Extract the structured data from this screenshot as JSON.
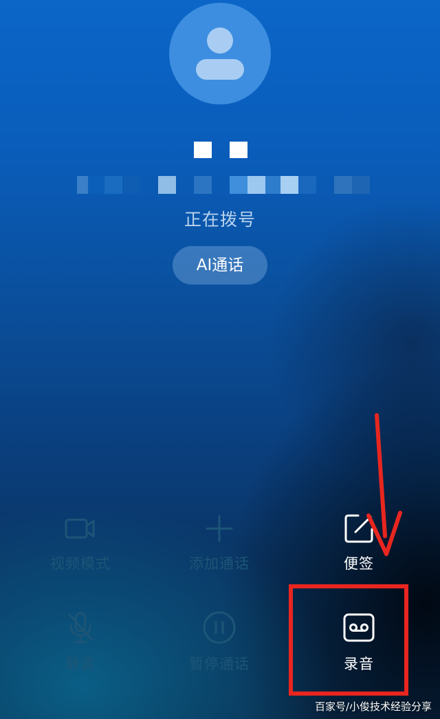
{
  "caller": {
    "status": "正在拨号",
    "ai_call_label": "AI通话"
  },
  "controls": {
    "video_mode": {
      "label": "视频模式",
      "icon": "video-camera-icon",
      "enabled": false
    },
    "add_call": {
      "label": "添加通话",
      "icon": "plus-icon",
      "enabled": false
    },
    "notes": {
      "label": "便签",
      "icon": "note-edit-icon",
      "enabled": true
    },
    "mute": {
      "label": "静音",
      "icon": "mic-off-icon",
      "enabled": false
    },
    "hold": {
      "label": "暂停通话",
      "icon": "pause-icon",
      "enabled": false
    },
    "record": {
      "label": "录音",
      "icon": "tape-record-icon",
      "enabled": true
    }
  },
  "annotation": {
    "highlight_color": "#e8261f",
    "target": "record"
  },
  "watermark": "百家号/小俊技术经验分享",
  "colors": {
    "background_top": "#0b66c8",
    "background_bottom": "#0a2d50",
    "avatar": "#3d8ee0",
    "status_text": "#b9d3ee",
    "disabled_control": "#1d5577"
  }
}
